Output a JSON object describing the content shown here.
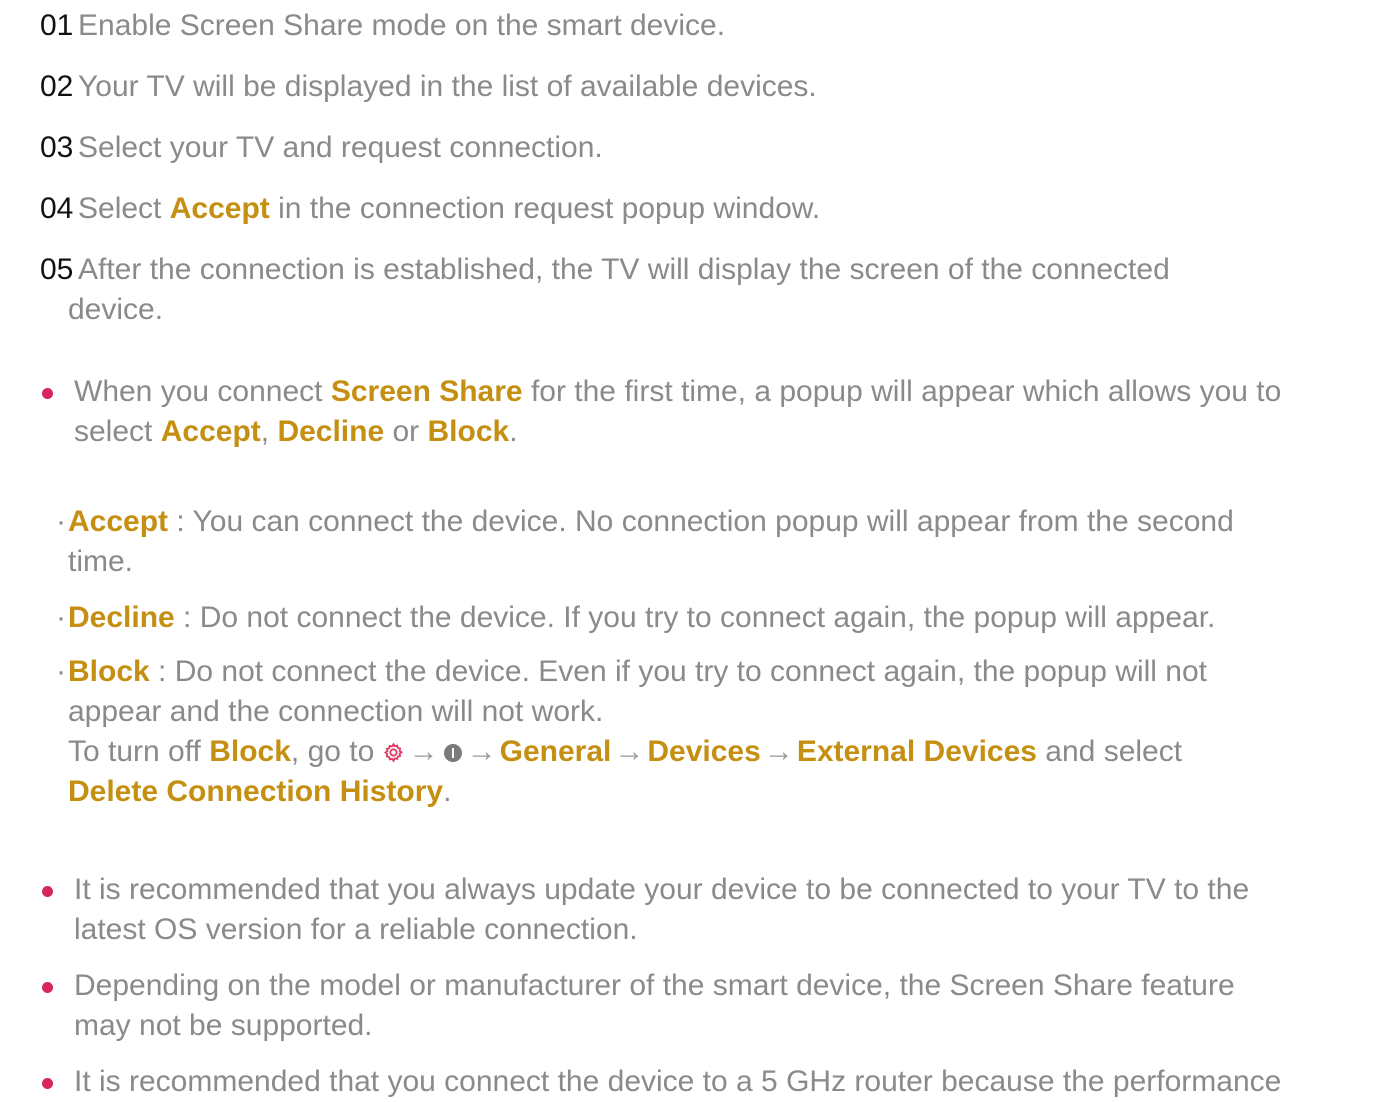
{
  "steps": [
    {
      "num": "01",
      "text": "Enable Screen Share mode on the smart device."
    },
    {
      "num": "02",
      "text": "Your TV will be displayed in the list of available devices."
    },
    {
      "num": "03",
      "text": "Select your TV and request connection."
    },
    {
      "num": "04",
      "pre": "Select ",
      "hl": "Accept",
      "post": " in the connection request popup window."
    },
    {
      "num": "05",
      "line1": "After the connection is established, the TV will display the screen of the connected",
      "line2": "device."
    }
  ],
  "notes": {
    "first": {
      "t1": "When you connect ",
      "h1": "Screen Share",
      "t2": " for the first time, a popup will appear which allows you to",
      "t3": "select ",
      "h2": "Accept",
      "t4": ", ",
      "h3": "Decline",
      "t5": " or ",
      "h4": "Block",
      "t6": "."
    },
    "accept": {
      "label": "Accept",
      "text": " : You can connect the device. No connection popup will appear from the second",
      "text2": "time."
    },
    "decline": {
      "label": "Decline",
      "text": " : Do not connect the device. If you try to connect again, the popup will appear."
    },
    "block": {
      "label": "Block",
      "text": " : Do not connect the device. Even if you try to connect again, the popup will not",
      "text2": "appear and the connection will not work.",
      "turnoff_pre": "To turn off ",
      "turnoff_hl": "Block",
      "turnoff_mid": ", go to ",
      "arrow": "→",
      "path1": "General",
      "path2": "Devices",
      "path3": "External Devices",
      "and_select": " and select",
      "delete": "Delete Connection History",
      "period": "."
    },
    "update": {
      "line1": "It is recommended that you always update your device to be connected to your TV to the",
      "line2": "latest OS version for a reliable connection."
    },
    "depending": {
      "line1": "Depending on the model or manufacturer of the smart device, the Screen Share feature",
      "line2": "may not be supported."
    },
    "router": {
      "line1": "It is recommended that you connect the device to a 5 GHz router because the performance"
    }
  },
  "icons": {
    "settings": "settings-gear-icon",
    "more": "more-info-icon"
  },
  "colors": {
    "highlight": "#c58f12",
    "bullet": "#d6275d",
    "text": "#8a8a8a",
    "number": "#111111"
  }
}
